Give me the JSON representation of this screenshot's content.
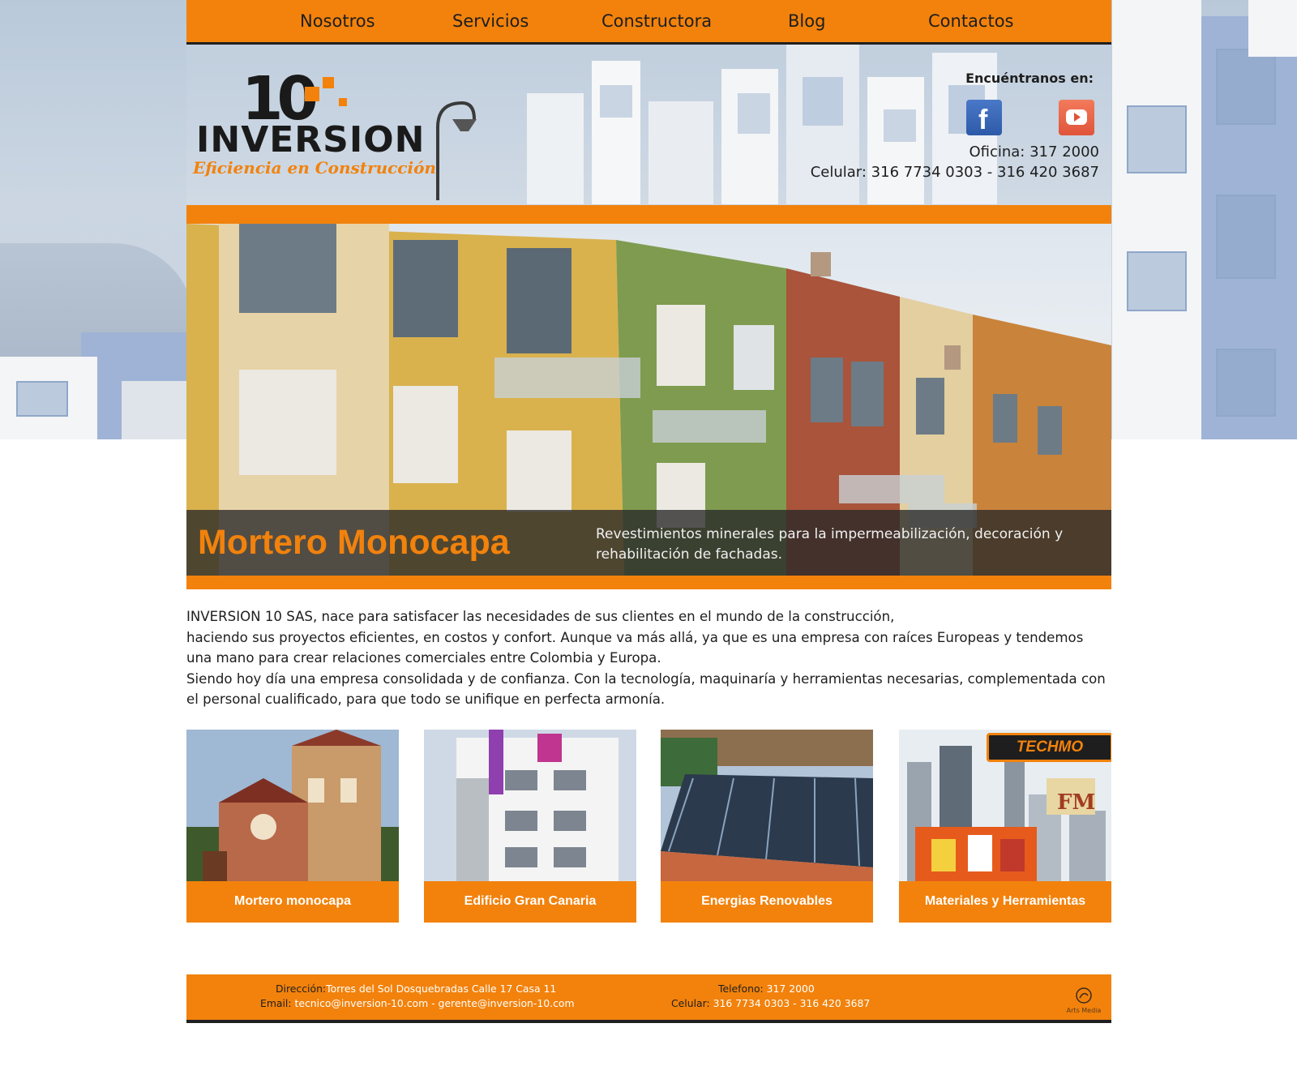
{
  "nav": {
    "items": [
      {
        "label": "Nosotros"
      },
      {
        "label": "Servicios"
      },
      {
        "label": "Constructora"
      },
      {
        "label": "Blog"
      },
      {
        "label": "Contactos"
      }
    ]
  },
  "logo": {
    "number": "10",
    "name": "INVERSION",
    "slogan": "Eficiencia en Construcción"
  },
  "header": {
    "find_us": "Encuéntranos en:",
    "facebook_icon": "facebook-icon",
    "youtube_icon": "youtube-icon",
    "office_label": "Oficina:",
    "office_phone": "317 2000",
    "cell_label": "Celular:",
    "cell_phones": "316 7734 0303 - 316 420 3687"
  },
  "slider": {
    "title": "Mortero Monocapa",
    "description": "Revestimientos minerales para la impermeabilización, decoración y rehabilitación de fachadas."
  },
  "intro": {
    "paragraphs": [
      "INVERSION 10 SAS, nace para satisfacer las necesidades de sus clientes en el mundo de la construcción,",
      "haciendo sus proyectos eficientes, en costos y confort. Aunque va más allá, ya que es una empresa con raíces Europeas y tendemos una mano para crear relaciones comerciales entre Colombia y Europa.",
      "Siendo hoy día una empresa consolidada y de confianza. Con la tecnología, maquinaría y herramientas necesarias, complementada con el personal cualificado, para que todo se unifique en perfecta armonía."
    ]
  },
  "cards": [
    {
      "label": "Mortero monocapa"
    },
    {
      "label": "Edificio Gran Canaria"
    },
    {
      "label": "Energias Renovables"
    },
    {
      "label": "Materiales y Herramientas",
      "brand": "TECHMO",
      "brand2": "FM"
    }
  ],
  "footer": {
    "address_label": "Dirección:",
    "address": "Torres del Sol Dosquebradas Calle 17 Casa 11",
    "email_label": "Email:",
    "emails": "tecnico@inversion-10.com - gerente@inversion-10.com",
    "phone_label": "Telefono:",
    "phone": "317 2000",
    "cell_label": "Celular:",
    "cells": "316 7734 0303 - 316 420 3687",
    "credit": "Arts Media"
  },
  "colors": {
    "accent": "#f2820c",
    "dark": "#1e1e1e"
  }
}
